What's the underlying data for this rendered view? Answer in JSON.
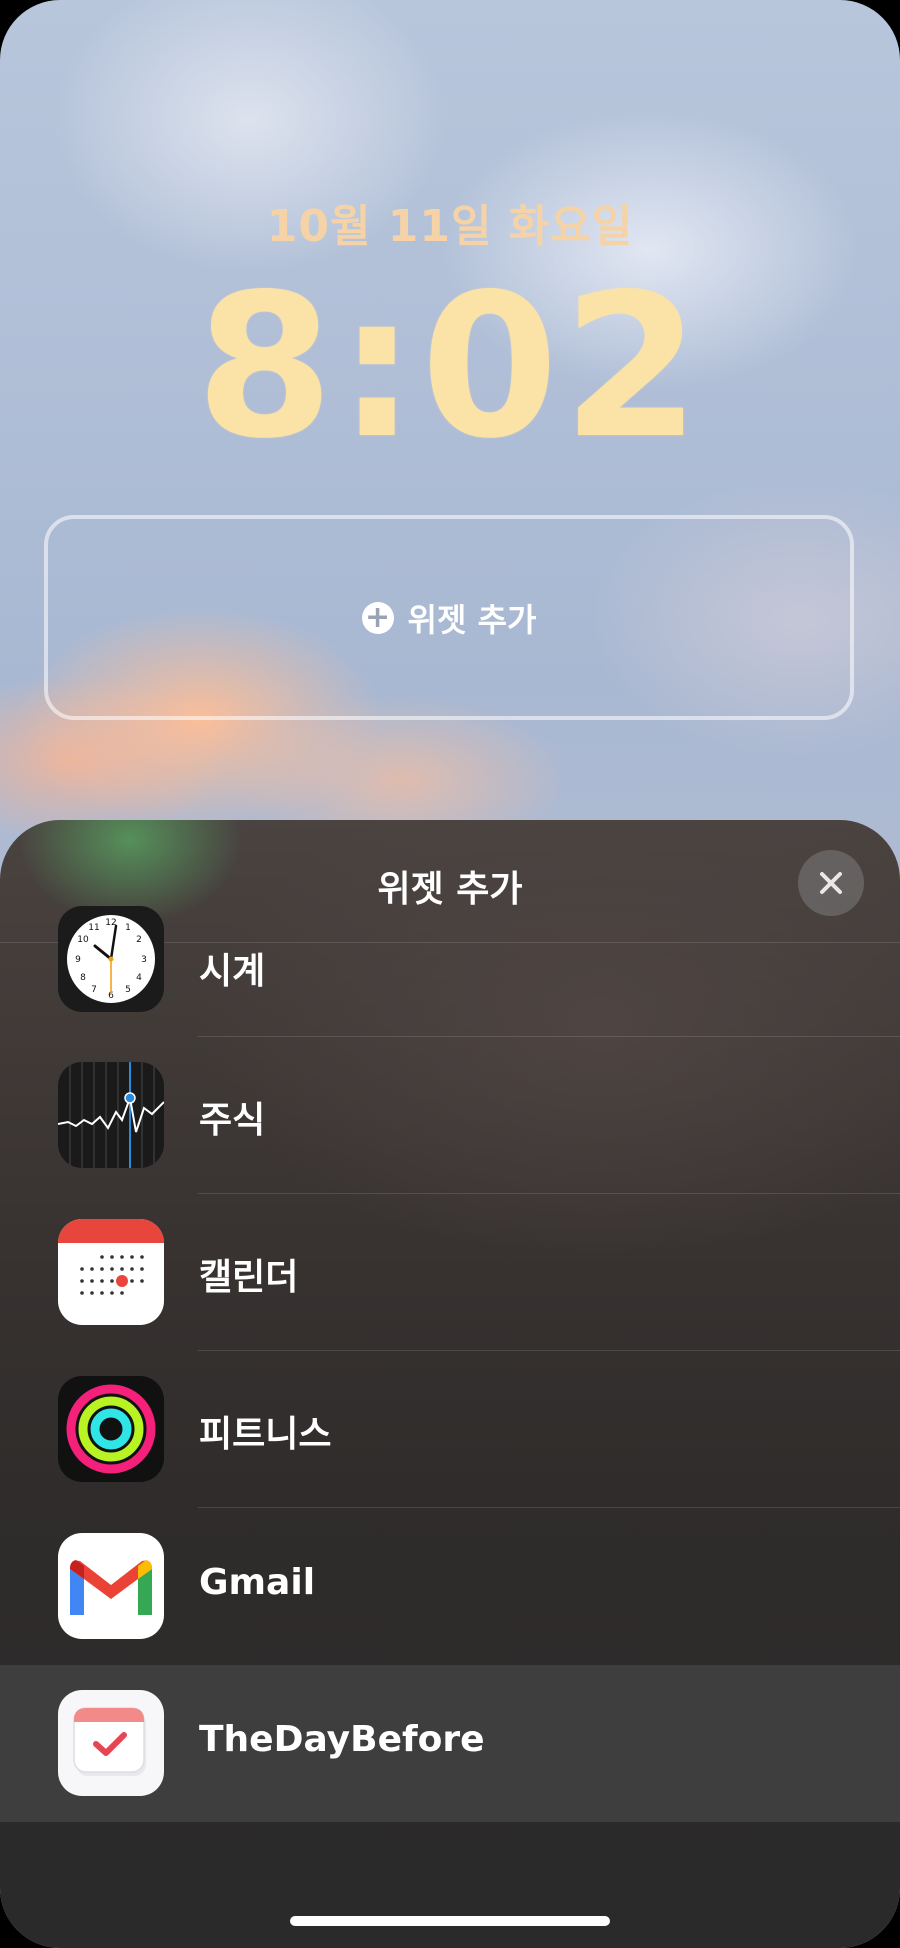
{
  "lockscreen": {
    "date": "10월 11일 화요일",
    "time": "8:02",
    "widget_slot_label": "위젯 추가"
  },
  "sheet": {
    "title": "위젯 추가",
    "close_icon": "xmark-icon",
    "apps": [
      {
        "name": "시계",
        "icon": "clock-icon"
      },
      {
        "name": "주식",
        "icon": "stocks-icon"
      },
      {
        "name": "캘린더",
        "icon": "calendar-icon"
      },
      {
        "name": "피트니스",
        "icon": "fitness-rings-icon"
      },
      {
        "name": "Gmail",
        "icon": "gmail-icon"
      },
      {
        "name": "TheDayBefore",
        "icon": "thedaybefore-icon",
        "selected": true
      }
    ]
  },
  "colors": {
    "date_text": "#f6d3a6",
    "time_text": "#fbe3a8",
    "sheet_background": "#2f2c2b",
    "selected_row": "#3e3e3e"
  }
}
